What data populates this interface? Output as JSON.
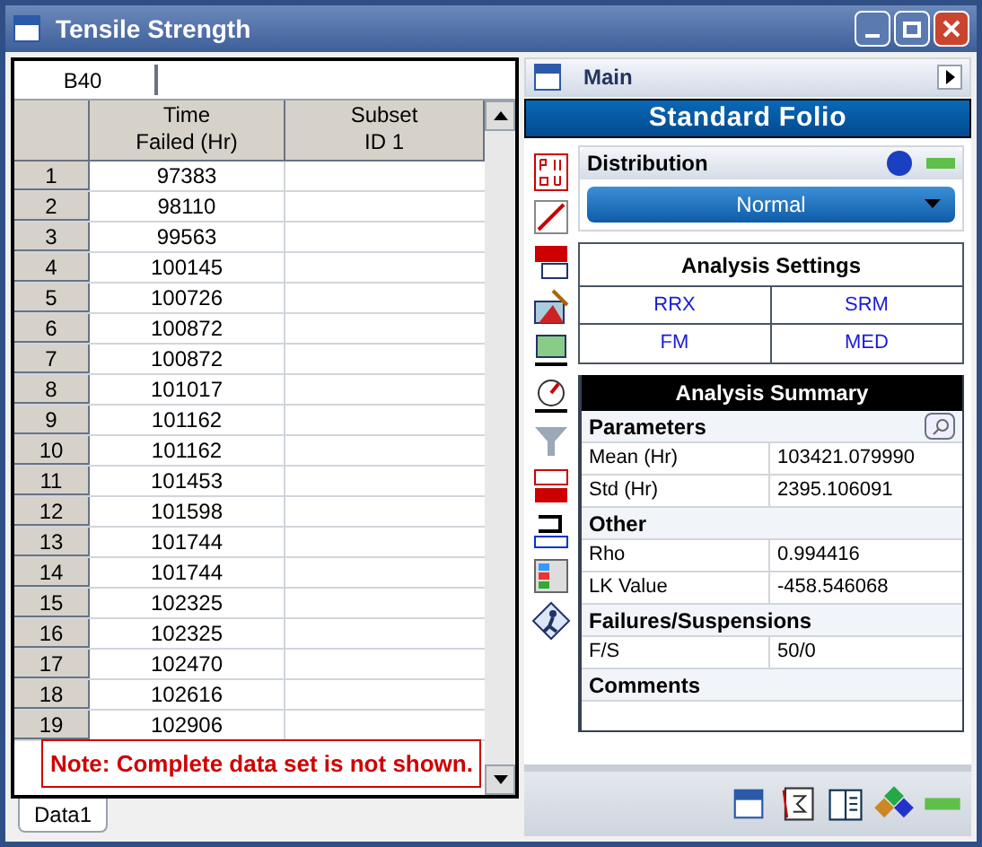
{
  "window": {
    "title": "Tensile Strength"
  },
  "cell_ref": {
    "value": "B40"
  },
  "table": {
    "columns": [
      "Time\nFailed (Hr)",
      "Subset\nID 1"
    ],
    "rows": [
      {
        "n": "1",
        "time": "97383"
      },
      {
        "n": "2",
        "time": "98110"
      },
      {
        "n": "3",
        "time": "99563"
      },
      {
        "n": "4",
        "time": "100145"
      },
      {
        "n": "5",
        "time": "100726"
      },
      {
        "n": "6",
        "time": "100872"
      },
      {
        "n": "7",
        "time": "100872"
      },
      {
        "n": "8",
        "time": "101017"
      },
      {
        "n": "9",
        "time": "101162"
      },
      {
        "n": "10",
        "time": "101162"
      },
      {
        "n": "11",
        "time": "101453"
      },
      {
        "n": "12",
        "time": "101598"
      },
      {
        "n": "13",
        "time": "101744"
      },
      {
        "n": "14",
        "time": "101744"
      },
      {
        "n": "15",
        "time": "102325"
      },
      {
        "n": "16",
        "time": "102325"
      },
      {
        "n": "17",
        "time": "102470"
      },
      {
        "n": "18",
        "time": "102616"
      },
      {
        "n": "19",
        "time": "102906"
      }
    ]
  },
  "note": "Note: Complete data set is not shown.",
  "sheet_tabs": [
    {
      "label": "Data1",
      "selected": true
    }
  ],
  "panel": {
    "title": "Main",
    "banner": "Standard Folio",
    "distribution": {
      "title": "Distribution",
      "value": "Normal"
    },
    "analysis_settings": {
      "title": "Analysis Settings",
      "options": [
        "RRX",
        "SRM",
        "FM",
        "MED"
      ]
    },
    "summary": {
      "title": "Analysis Summary",
      "sections": [
        {
          "title": "Parameters",
          "rows": [
            {
              "label": "Mean (Hr)",
              "value": "103421.079990"
            },
            {
              "label": "Std (Hr)",
              "value": "2395.106091"
            }
          ]
        },
        {
          "title": "Other",
          "rows": [
            {
              "label": "Rho",
              "value": "0.994416"
            },
            {
              "label": "LK Value",
              "value": "-458.546068"
            }
          ]
        },
        {
          "title": "Failures/Suspensions",
          "rows": [
            {
              "label": "F/S",
              "value": "50/0"
            }
          ]
        },
        {
          "title": "Comments"
        }
      ]
    }
  }
}
